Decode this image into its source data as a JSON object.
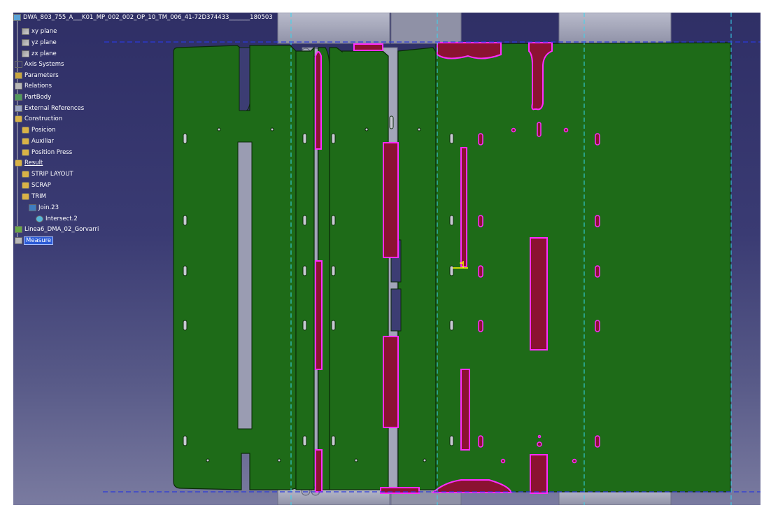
{
  "tree": {
    "root": "DWA_803_755_A___K01_MP_002_002_OP_10_TM_006_41-72D374433_______180503",
    "items": [
      {
        "label": "xy plane",
        "icon": "plane-icon"
      },
      {
        "label": "yz plane",
        "icon": "plane-icon"
      },
      {
        "label": "zx plane",
        "icon": "plane-icon"
      },
      {
        "label": "Axis Systems",
        "icon": "axis-system-icon"
      },
      {
        "label": "Parameters",
        "icon": "parameters-icon"
      },
      {
        "label": "Relations",
        "icon": "relations-icon"
      },
      {
        "label": "PartBody",
        "icon": "part-body-icon"
      },
      {
        "label": "External References",
        "icon": "external-references-icon"
      },
      {
        "label": "Construction",
        "icon": "geometrical-set-icon"
      },
      {
        "label": "Posicion",
        "icon": "geometrical-set-icon"
      },
      {
        "label": "Auxiliar",
        "icon": "geometrical-set-icon"
      },
      {
        "label": "Position Press",
        "icon": "geometrical-set-icon"
      },
      {
        "label": "Result",
        "icon": "geometrical-set-icon"
      },
      {
        "label": "STRIP LAYOUT",
        "icon": "geometrical-set-icon"
      },
      {
        "label": "SCRAP",
        "icon": "geometrical-set-icon"
      },
      {
        "label": "TRIM",
        "icon": "geometrical-set-icon"
      },
      {
        "label": "Join.23",
        "icon": "join-icon"
      },
      {
        "label": "Intersect.2",
        "icon": "intersect-icon"
      },
      {
        "label": "Linea6_DMA_02_Gorvarri",
        "icon": "line-icon"
      },
      {
        "label": "Measure",
        "icon": "measure-icon"
      }
    ]
  },
  "colors": {
    "part_fill": "#1e6b18",
    "part_edge": "#0b2a08",
    "scrap_fill": "#8b1232",
    "scrap_edge": "#ff2cff",
    "hole_fill": "#c8c9d3",
    "tool_gray": "#9d9fb4",
    "guide_line": "#36d7f0",
    "strip_line": "#2b39d9",
    "selection": "#2c5bd6"
  }
}
